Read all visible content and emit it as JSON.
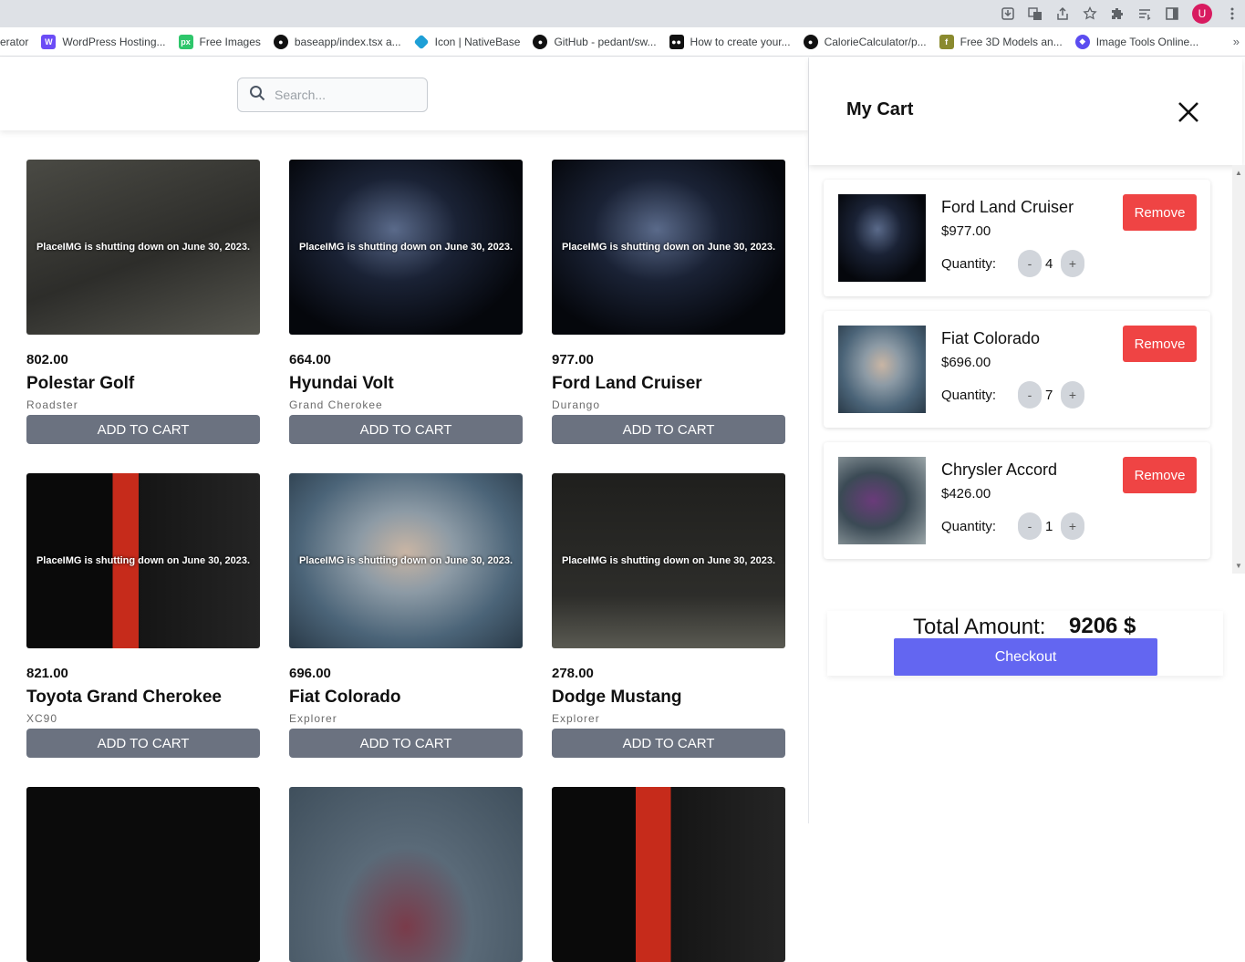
{
  "bookmarks": [
    {
      "label": "erator",
      "icon": "generic-bookmark-icon",
      "color": ""
    },
    {
      "label": "WordPress Hosting...",
      "icon": "wordpress-hosting-icon",
      "color": "#6b4cf6"
    },
    {
      "label": "Free Images",
      "icon": "pixabay-icon",
      "color": "#2ec66b"
    },
    {
      "label": "baseapp/index.tsx a...",
      "icon": "github-icon",
      "color": "#111111"
    },
    {
      "label": "Icon | NativeBase",
      "icon": "nativebase-icon",
      "color": "#1e9fd6"
    },
    {
      "label": "GitHub - pedant/sw...",
      "icon": "github-icon",
      "color": "#111111"
    },
    {
      "label": "How to create your...",
      "icon": "medium-icon",
      "color": "#111111"
    },
    {
      "label": "CalorieCalculator/p...",
      "icon": "github-icon",
      "color": "#111111"
    },
    {
      "label": "Free 3D Models an...",
      "icon": "free3d-icon",
      "color": "#8a8a2e"
    },
    {
      "label": "Image Tools Online...",
      "icon": "image-tools-icon",
      "color": "#5b4cf0"
    }
  ],
  "profile_initial": "U",
  "search": {
    "placeholder": "Search..."
  },
  "products": [
    {
      "price": "802.00",
      "name": "Polestar Golf",
      "model": "Roadster",
      "button": "ADD TO CART",
      "image_text": "PlaceIMG is shutting down on June 30, 2023.",
      "tone": "#3a3a36"
    },
    {
      "price": "664.00",
      "name": "Hyundai Volt",
      "model": "Grand Cherokee",
      "button": "ADD TO CART",
      "image_text": "PlaceIMG is shutting down on June 30, 2023.",
      "tone": "#0d1424"
    },
    {
      "price": "977.00",
      "name": "Ford Land Cruiser",
      "model": "Durango",
      "button": "ADD TO CART",
      "image_text": "PlaceIMG is shutting down on June 30, 2023.",
      "tone": "#0d1424"
    },
    {
      "price": "821.00",
      "name": "Toyota Grand Cherokee",
      "model": "XC90",
      "button": "ADD TO CART",
      "image_text": "PlaceIMG is shutting down on June 30, 2023.",
      "tone": "#1c1c1c"
    },
    {
      "price": "696.00",
      "name": "Fiat Colorado",
      "model": "Explorer",
      "button": "ADD TO CART",
      "image_text": "PlaceIMG is shutting down on June 30, 2023.",
      "tone": "#4b6478"
    },
    {
      "price": "278.00",
      "name": "Dodge Mustang",
      "model": "Explorer",
      "button": "ADD TO CART",
      "image_text": "PlaceIMG is shutting down on June 30, 2023.",
      "tone": "#3a3a36"
    }
  ],
  "cart": {
    "title": "My Cart",
    "items": [
      {
        "name": "Ford Land Cruiser",
        "price": "$977.00",
        "quantity_label": "Quantity:",
        "quantity": "4",
        "remove": "Remove",
        "tone": "#0d1424"
      },
      {
        "name": "Fiat Colorado",
        "price": "$696.00",
        "quantity_label": "Quantity:",
        "quantity": "7",
        "remove": "Remove",
        "tone": "#4b6478"
      },
      {
        "name": "Chrysler Accord",
        "price": "$426.00",
        "quantity_label": "Quantity:",
        "quantity": "1",
        "remove": "Remove",
        "tone": "#3b4a55"
      }
    ],
    "minus": "-",
    "plus": "+",
    "total_label": "Total Amount:",
    "total_value": "9206 $",
    "checkout": "Checkout"
  },
  "colors": {
    "add_button": "#6b7280",
    "remove_button": "#ef4444",
    "checkout_button": "#6366f1"
  }
}
